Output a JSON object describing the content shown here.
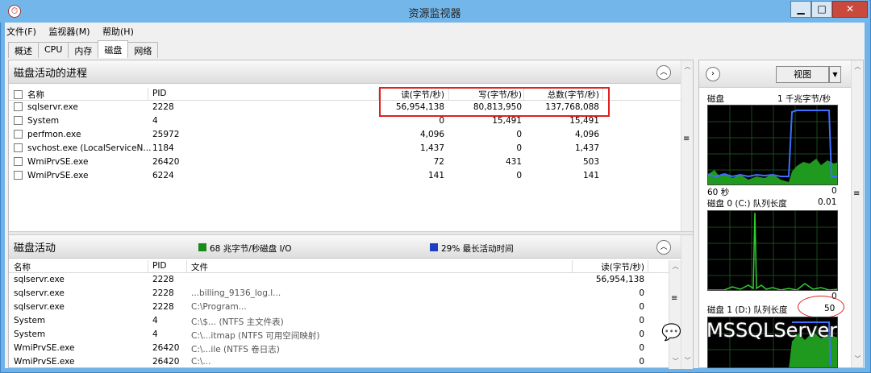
{
  "window": {
    "title": "资源监视器",
    "min": "▁",
    "max": "□",
    "close": "✕"
  },
  "menu": [
    "文件(F)",
    "监视器(M)",
    "帮助(H)"
  ],
  "tabs": [
    "概述",
    "CPU",
    "内存",
    "磁盘",
    "网络"
  ],
  "active_tab": "磁盘",
  "processes": {
    "title": "磁盘活动的进程",
    "columns": [
      "名称",
      "PID",
      "读(字节/秒)",
      "写(字节/秒)",
      "总数(字节/秒)"
    ],
    "rows": [
      {
        "name": "sqlservr.exe",
        "pid": "2228",
        "read": "56,954,138",
        "write": "80,813,950",
        "total": "137,768,088"
      },
      {
        "name": "System",
        "pid": "4",
        "read": "0",
        "write": "15,491",
        "total": "15,491"
      },
      {
        "name": "perfmon.exe",
        "pid": "25972",
        "read": "4,096",
        "write": "0",
        "total": "4,096"
      },
      {
        "name": "svchost.exe (LocalServiceN...",
        "pid": "1184",
        "read": "1,437",
        "write": "0",
        "total": "1,437"
      },
      {
        "name": "WmiPrvSE.exe",
        "pid": "26420",
        "read": "72",
        "write": "431",
        "total": "503"
      },
      {
        "name": "WmiPrvSE.exe",
        "pid": "6224",
        "read": "141",
        "write": "0",
        "total": "141"
      }
    ]
  },
  "disk_activity": {
    "title": "磁盘活动",
    "io_legend": "68 兆字节/秒磁盘 I/O",
    "active_legend": "29% 最长活动时间",
    "io_color": "#1a8a1a",
    "active_color": "#1f3fbf",
    "columns": [
      "名称",
      "PID",
      "文件",
      "读(字节/秒)"
    ],
    "rows": [
      {
        "name": "sqlservr.exe",
        "pid": "2228",
        "file": "",
        "read": "56,954,138"
      },
      {
        "name": "sqlservr.exe",
        "pid": "2228",
        "file": "...billing_9136_log.l...",
        "read": "0"
      },
      {
        "name": "sqlservr.exe",
        "pid": "2228",
        "file": "C:\\Program...",
        "read": "0"
      },
      {
        "name": "System",
        "pid": "4",
        "file": "C:\\$...   (NTFS 主文件表)",
        "read": "0"
      },
      {
        "name": "System",
        "pid": "4",
        "file": "C:\\...itmap (NTFS 可用空间映射)",
        "read": "0"
      },
      {
        "name": "WmiPrvSE.exe",
        "pid": "26420",
        "file": "C:\\...ile (NTFS 卷日志)",
        "read": "0"
      },
      {
        "name": "WmiPrvSE.exe",
        "pid": "26420",
        "file": "C:\\...",
        "read": "0"
      }
    ]
  },
  "right_panel": {
    "view_label": "视图",
    "graph1": {
      "title": "磁盘",
      "scale": "1 千兆字节/秒",
      "time": "60 秒",
      "min": "0"
    },
    "graph2": {
      "title": "磁盘 0 (C:) 队列长度",
      "scale": "0.01",
      "min": "0"
    },
    "graph3": {
      "title": "磁盘 1 (D:) 队列长度",
      "scale": "50"
    }
  },
  "watermark": "MSSQLServer",
  "highlight_color": "#e02020"
}
